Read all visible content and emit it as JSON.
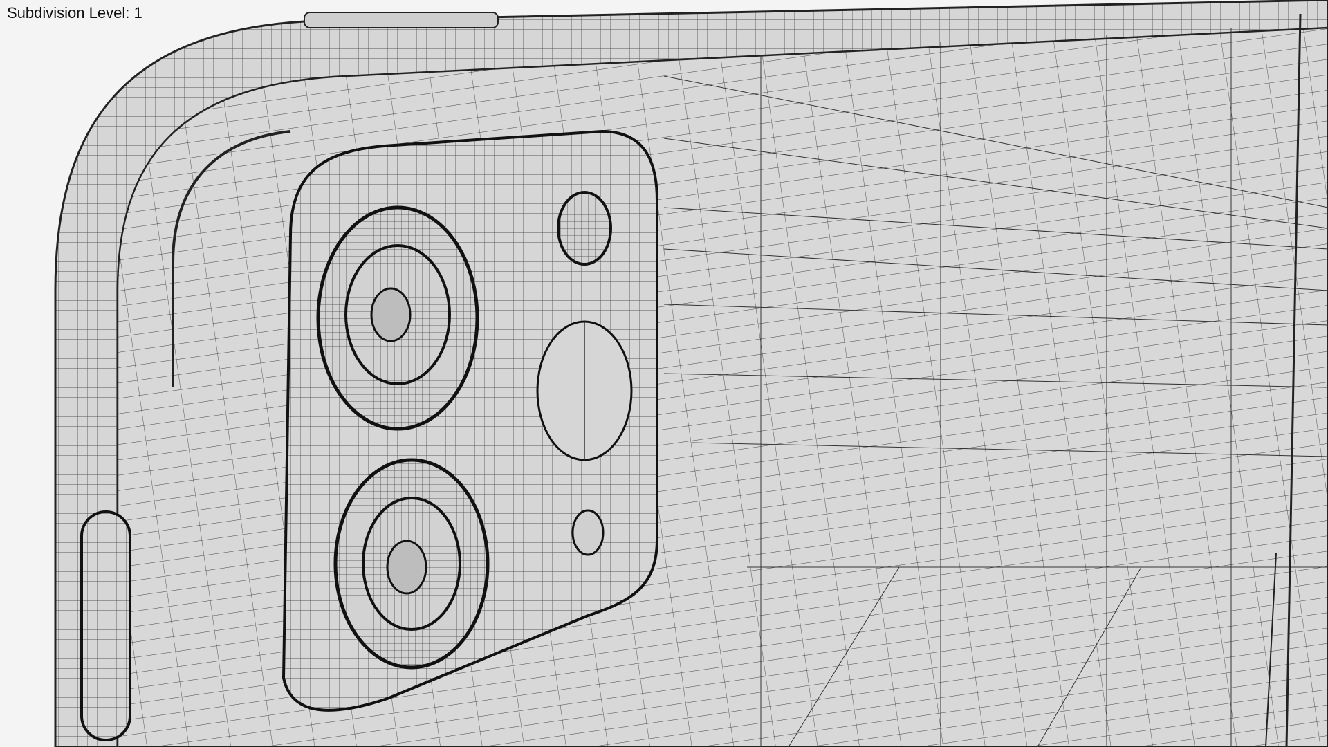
{
  "overlay": {
    "label": "Subdivision Level: 1"
  },
  "colors": {
    "background": "#f4f4f4",
    "surface": "#d6d6d6",
    "wire": "#333333"
  }
}
